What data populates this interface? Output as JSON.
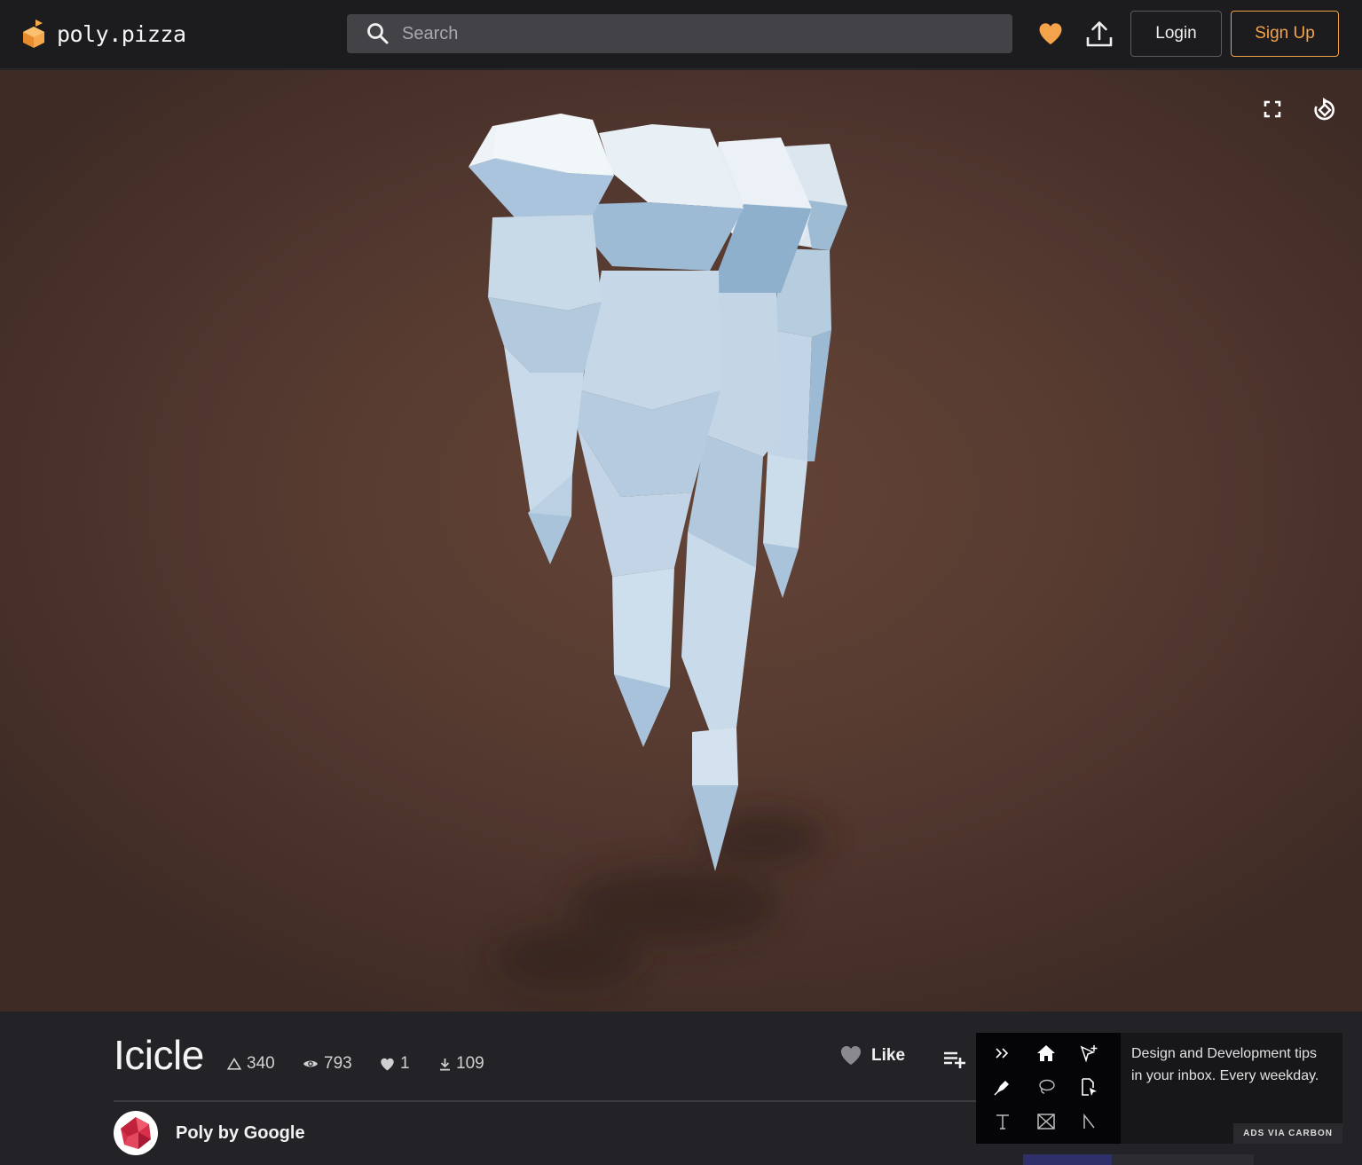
{
  "app": {
    "logo_text": "poly.pizza",
    "brand_color": "#f5a34a"
  },
  "search": {
    "placeholder": "Search"
  },
  "header": {
    "favorites_icon": "heart-icon",
    "upload_icon": "upload-icon",
    "login_label": "Login",
    "signup_label": "Sign Up"
  },
  "viewer": {
    "fullscreen_icon": "fullscreen-icon",
    "rotate_icon": "auto-rotate-icon",
    "background_color": "#5a3d32",
    "model_color": "#c6d8e8"
  },
  "model": {
    "title": "Icicle",
    "stats": {
      "triangles": "340",
      "views": "793",
      "likes": "1",
      "downloads": "109"
    },
    "like_label": "Like",
    "author": "Poly by Google"
  },
  "ad": {
    "text": "Design and Development tips in your inbox. Every weekday.",
    "via_label": "ADS VIA CARBON"
  }
}
